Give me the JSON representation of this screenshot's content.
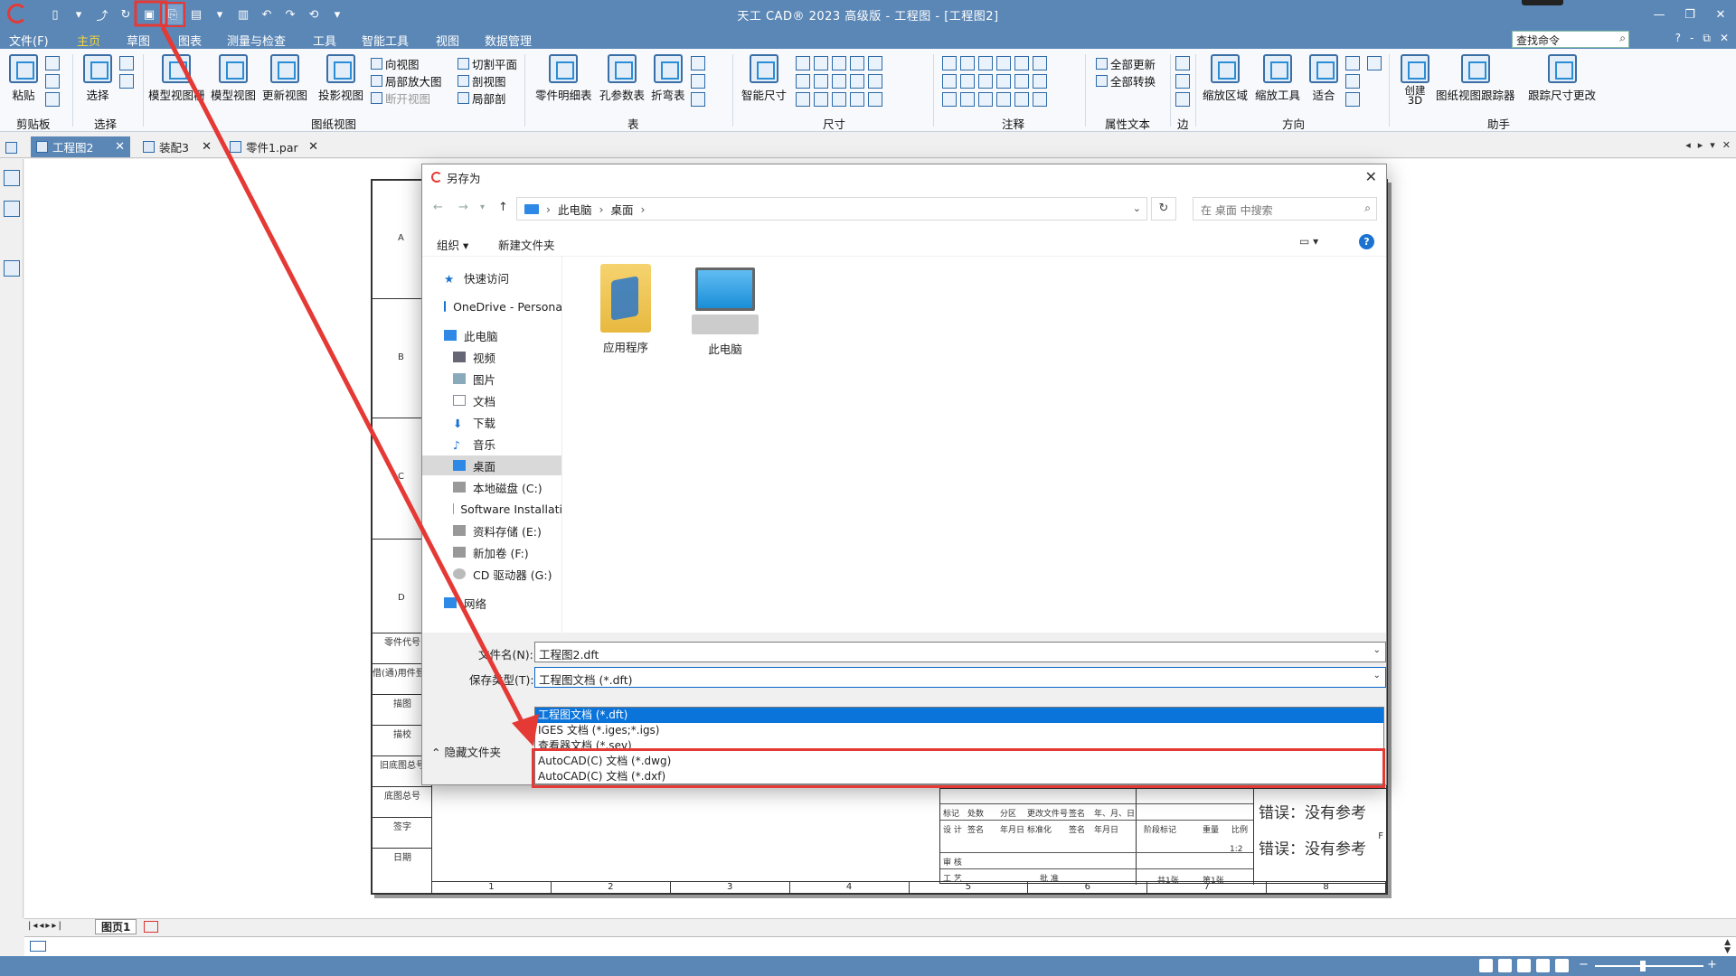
{
  "app": {
    "title": "天工 CAD® 2023 高级版 - 工程图 - [工程图2]",
    "menus": [
      "文件(F)",
      "主页",
      "草图",
      "图表",
      "测量与检查",
      "工具",
      "智能工具",
      "视图",
      "数据管理"
    ],
    "search_placeholder": "查找命令",
    "help_buttons": [
      "?",
      "-",
      "⧉",
      "✕"
    ]
  },
  "ribbon": {
    "clipboard": {
      "paste": "粘贴",
      "group": "剪贴板"
    },
    "select": {
      "label": "选择",
      "group": "选择"
    },
    "drawing_views": {
      "model_view_creator": "模型视图栅",
      "model_view": "模型视图",
      "update_view": "更新视图",
      "projection_view": "投影视图",
      "aux_view": "向视图",
      "detail_view": "局部放大图",
      "broken_view": "断开视图",
      "section_plane": "切割平面",
      "section_view": "剖视图",
      "partial_section": "局部剖",
      "group": "图纸视图"
    },
    "tables": {
      "parts_list": "零件明细表",
      "hole_table": "孔参数表",
      "bend_table": "折弯表",
      "group": "表"
    },
    "dimension": {
      "smart": "智能尺寸",
      "group": "尺寸"
    },
    "annotation": {
      "group": "注释"
    },
    "property_text": {
      "update_all": "全部更新",
      "convert_all": "全部转换",
      "group": "属性文本"
    },
    "edge": {
      "group": "边"
    },
    "orientation": {
      "zoom_area": "缩放区域",
      "zoom_tool": "缩放工具",
      "fit": "适合",
      "group": "方向"
    },
    "assistant": {
      "create_3d": "创建 3D",
      "tracker": "图纸视图跟踪器",
      "track_dims": "跟踪尺寸更改",
      "group": "助手"
    }
  },
  "tabs": [
    {
      "label": "工程图2",
      "active": true
    },
    {
      "label": "装配3",
      "active": false
    },
    {
      "label": "零件1.par",
      "active": false
    }
  ],
  "sheet": {
    "zones": [
      "A",
      "B",
      "C",
      "D"
    ],
    "left_boxes": [
      "零件代号",
      "借(通)用件登记",
      "描图",
      "描校",
      "旧底图总号",
      "底图总号",
      "签字",
      "日期"
    ],
    "scale_numbers": [
      "1",
      "2",
      "3",
      "4",
      "5",
      "6",
      "7",
      "8"
    ],
    "zone_f": "F",
    "title_block": {
      "error_text_1": "错误：没有参考",
      "error_text_2": "错误：没有参考",
      "header_cells": [
        "标记",
        "处数",
        "分区",
        "更改文件号",
        "签名",
        "年、月、日"
      ],
      "row2": [
        "设 计",
        "签名",
        "年月日",
        "标准化",
        "签名",
        "年月日"
      ],
      "row3": [
        "审 核"
      ],
      "row4": [
        "工 艺",
        "批 准"
      ],
      "stage_mark": "阶段标记",
      "weight": "重量",
      "scale": "比例",
      "scale_value": "1:2",
      "sheets_total": "共1张",
      "sheet_no": "第1张",
      "top_text": "错误：没有参考"
    }
  },
  "dialog": {
    "title": "另存为",
    "breadcrumb": [
      "此电脑",
      "桌面"
    ],
    "search_placeholder": "在 桌面 中搜索",
    "organize": "组织 ▾",
    "new_folder": "新建文件夹",
    "nav_items": [
      {
        "label": "快速访问",
        "indent": 1
      },
      {
        "label": "OneDrive - Persona",
        "indent": 1
      },
      {
        "label": "此电脑",
        "indent": 1
      },
      {
        "label": "视频",
        "indent": 2
      },
      {
        "label": "图片",
        "indent": 2
      },
      {
        "label": "文档",
        "indent": 2
      },
      {
        "label": "下载",
        "indent": 2
      },
      {
        "label": "音乐",
        "indent": 2
      },
      {
        "label": "桌面",
        "indent": 2,
        "selected": true
      },
      {
        "label": "本地磁盘 (C:)",
        "indent": 2
      },
      {
        "label": "Software Installati",
        "indent": 2
      },
      {
        "label": "资料存储 (E:)",
        "indent": 2
      },
      {
        "label": "新加卷 (F:)",
        "indent": 2
      },
      {
        "label": "CD 驱动器 (G:)",
        "indent": 2
      },
      {
        "label": "网络",
        "indent": 1
      }
    ],
    "files": [
      {
        "label": "应用程序",
        "icon": "folder-icon"
      },
      {
        "label": "此电脑",
        "icon": "computer-icon"
      }
    ],
    "filename_label": "文件名(N):",
    "filename_value": "工程图2.dft",
    "filetype_label": "保存类型(T):",
    "filetype_value": "工程图文档 (*.dft)",
    "filetype_options": [
      {
        "label": "工程图文档 (*.dft)",
        "selected": true
      },
      {
        "label": "IGES 文档 (*.iges;*.igs)",
        "selected": false
      },
      {
        "label": "查看器文档 (*.sev)",
        "selected": false
      },
      {
        "label": "AutoCAD(C) 文档 (*.dwg)",
        "selected": false
      },
      {
        "label": "AutoCAD(C) 文档 (*.dxf)",
        "selected": false
      }
    ],
    "hide_folders": "隐藏文件夹"
  },
  "bottom": {
    "sheet_tab": "图页1",
    "highlight_color": "#e53935",
    "accent_color": "#5b87b6"
  }
}
